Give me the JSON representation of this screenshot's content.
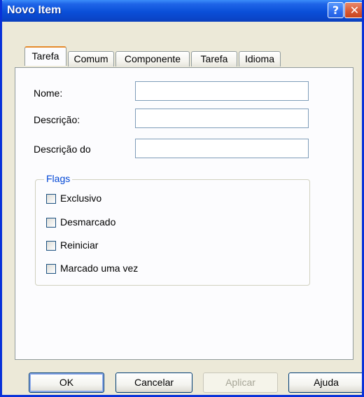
{
  "window": {
    "title": "Novo Item"
  },
  "titlebar_buttons": {
    "help": "?",
    "close": "✕"
  },
  "tabs": [
    {
      "label": "Tarefa",
      "active": true
    },
    {
      "label": "Comum",
      "active": false
    },
    {
      "label": "Componente",
      "active": false
    },
    {
      "label": "Tarefa",
      "active": false
    },
    {
      "label": "Idioma",
      "active": false
    }
  ],
  "fields": [
    {
      "label": "Nome:",
      "value": ""
    },
    {
      "label": "Descrição:",
      "value": ""
    },
    {
      "label": "Descrição do",
      "value": ""
    }
  ],
  "flags": {
    "title": "Flags",
    "items": [
      {
        "label": "Exclusivo",
        "checked": false
      },
      {
        "label": "Desmarcado",
        "checked": false
      },
      {
        "label": "Reiniciar",
        "checked": false
      },
      {
        "label": "Marcado uma vez",
        "checked": false
      }
    ]
  },
  "buttons": {
    "ok": "OK",
    "cancel": "Cancelar",
    "apply": "Aplicar",
    "help": "Ajuda"
  },
  "colors": {
    "titlebar": "#0a4fd8",
    "dialog_bg": "#ece9d8",
    "tab_highlight": "#e68b2c",
    "group_title": "#0046d5"
  }
}
